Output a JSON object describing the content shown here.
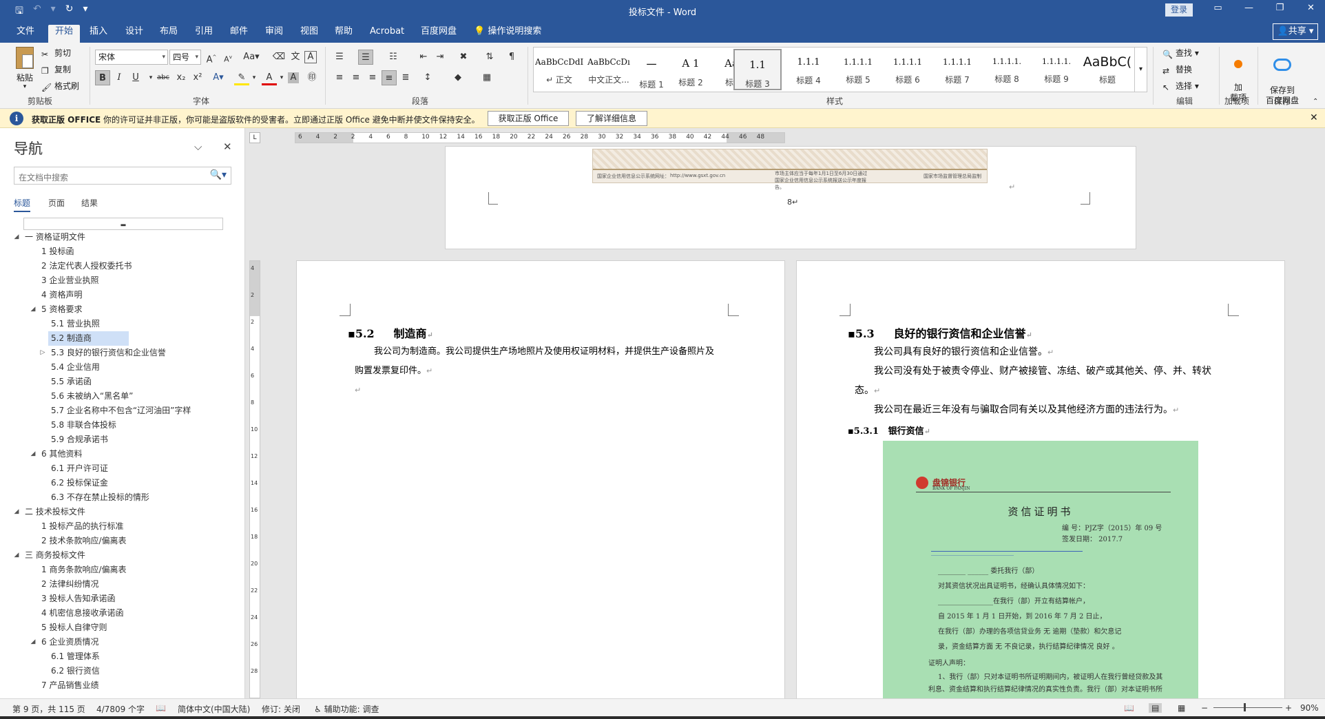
{
  "titlebar": {
    "doc_title": "投标文件 - Word",
    "login": "登录",
    "save_icon": "save-icon",
    "undo_icon": "undo-icon",
    "redo_icon": "redo-icon",
    "customize_icon": "customize-qat-icon"
  },
  "menu": {
    "tabs": [
      "文件",
      "开始",
      "插入",
      "设计",
      "布局",
      "引用",
      "邮件",
      "审阅",
      "视图",
      "帮助",
      "Acrobat",
      "百度网盘"
    ],
    "active_tab": "开始",
    "tell_me": "操作说明搜索",
    "share": "共享"
  },
  "ribbon": {
    "clipboard": {
      "label": "剪贴板",
      "paste": "粘贴",
      "cut": "剪切",
      "copy": "复制",
      "format_painter": "格式刷"
    },
    "font": {
      "label": "字体",
      "font_name": "宋体",
      "font_size": "四号",
      "bold": "B",
      "italic": "I",
      "underline": "U",
      "strike": "abc",
      "subscript": "x₂",
      "superscript": "x²"
    },
    "paragraph": {
      "label": "段落"
    },
    "styles": {
      "label": "样式",
      "items": [
        {
          "preview": "AaBbCcDdI",
          "name": "↵ 正文"
        },
        {
          "preview": "AaBbCcDı",
          "name": "中文正文..."
        },
        {
          "preview": "一",
          "name": "标题 1"
        },
        {
          "preview": "A 1",
          "name": "标题 2"
        },
        {
          "preview": "AaI",
          "name": "标题"
        },
        {
          "preview": "1.1",
          "name": "标题 3"
        },
        {
          "preview": "1.1.1",
          "name": "标题 4"
        },
        {
          "preview": "1.1.1.1",
          "name": "标题 5"
        },
        {
          "preview": "1.1.1.1",
          "name": "标题 6"
        },
        {
          "preview": "1.1.1.1",
          "name": "标题 7"
        },
        {
          "preview": "1.1.1.1.",
          "name": "标题 8"
        },
        {
          "preview": "1.1.1.1.",
          "name": "标题 9"
        },
        {
          "preview": "AaBbC(",
          "name": "标题"
        }
      ],
      "selected_index": 5
    },
    "editing": {
      "label": "编辑",
      "find": "查找",
      "replace": "替换",
      "select": "选择"
    },
    "addins": {
      "label": "加载项",
      "button": "加\n载项"
    },
    "save": {
      "label": "保存",
      "button": "保存到\n百度网盘"
    }
  },
  "infobar": {
    "icon": "info-icon",
    "bold": "获取正版 OFFICE",
    "message": "你的许可证并非正版，你可能是盗版软件的受害者。立即通过正版 Office 避免中断并使文件保持安全。",
    "btn_get": "获取正版 Office",
    "btn_learn": "了解详细信息"
  },
  "nav": {
    "title": "导航",
    "search_placeholder": "在文档中搜索",
    "tabs": [
      "标题",
      "页面",
      "结果"
    ],
    "active_tab": "标题",
    "tree": [
      {
        "level": 0,
        "toggle": "◢",
        "label": "一 资格证明文件"
      },
      {
        "level": 1,
        "toggle": "",
        "label": "1 投标函"
      },
      {
        "level": 1,
        "toggle": "",
        "label": "2 法定代表人授权委托书"
      },
      {
        "level": 1,
        "toggle": "",
        "label": "3 企业营业执照"
      },
      {
        "level": 1,
        "toggle": "",
        "label": "4 资格声明"
      },
      {
        "level": 1,
        "toggle": "◢",
        "label": "5 资格要求"
      },
      {
        "level": 2,
        "toggle": "",
        "label": "5.1 营业执照"
      },
      {
        "level": 2,
        "toggle": "",
        "label": "5.2 制造商",
        "selected": true
      },
      {
        "level": 2,
        "toggle": "▷",
        "label": "5.3 良好的银行资信和企业信誉"
      },
      {
        "level": 2,
        "toggle": "",
        "label": "5.4 企业信用"
      },
      {
        "level": 2,
        "toggle": "",
        "label": "5.5 承诺函"
      },
      {
        "level": 2,
        "toggle": "",
        "label": "5.6 未被纳入“黑名单”"
      },
      {
        "level": 2,
        "toggle": "",
        "label": "5.7 企业名称中不包含“辽河油田”字样"
      },
      {
        "level": 2,
        "toggle": "",
        "label": "5.8 非联合体投标"
      },
      {
        "level": 2,
        "toggle": "",
        "label": "5.9 合规承诺书"
      },
      {
        "level": 1,
        "toggle": "◢",
        "label": "6 其他资料"
      },
      {
        "level": 2,
        "toggle": "",
        "label": "6.1 开户许可证"
      },
      {
        "level": 2,
        "toggle": "",
        "label": "6.2 投标保证金"
      },
      {
        "level": 2,
        "toggle": "",
        "label": "6.3 不存在禁止投标的情形"
      },
      {
        "level": 0,
        "toggle": "◢",
        "label": "二 技术投标文件"
      },
      {
        "level": 1,
        "toggle": "",
        "label": "1 投标产品的执行标准"
      },
      {
        "level": 1,
        "toggle": "",
        "label": "2 技术条款响应/偏离表"
      },
      {
        "level": 0,
        "toggle": "◢",
        "label": "三 商务投标文件"
      },
      {
        "level": 1,
        "toggle": "",
        "label": "1 商务条款响应/偏离表"
      },
      {
        "level": 1,
        "toggle": "",
        "label": "2 法律纠纷情况"
      },
      {
        "level": 1,
        "toggle": "",
        "label": "3 投标人告知承诺函"
      },
      {
        "level": 1,
        "toggle": "",
        "label": "4 机密信息接收承诺函"
      },
      {
        "level": 1,
        "toggle": "",
        "label": "5 投标人自律守则"
      },
      {
        "level": 1,
        "toggle": "◢",
        "label": "6 企业资质情况"
      },
      {
        "level": 2,
        "toggle": "",
        "label": "6.1 管理体系"
      },
      {
        "level": 2,
        "toggle": "",
        "label": "6.2 银行资信"
      },
      {
        "level": 1,
        "toggle": "",
        "label": "7 产品销售业绩"
      }
    ]
  },
  "ruler": {
    "h_labels": [
      "6",
      "4",
      "2",
      "2",
      "4",
      "6",
      "8",
      "10",
      "12",
      "14",
      "16",
      "18",
      "20",
      "22",
      "24",
      "26",
      "28",
      "30",
      "32",
      "34",
      "36",
      "38",
      "40",
      "42",
      "44",
      "46",
      "48"
    ],
    "v_labels": [
      "4",
      "2",
      "2",
      "4",
      "6",
      "8",
      "10",
      "12",
      "14",
      "16",
      "18",
      "20",
      "22",
      "24",
      "26",
      "28"
    ],
    "corner": "L"
  },
  "document": {
    "prev_page": {
      "page_number": "8↵",
      "cert_left": "国家企业信用信息公示系统网址：",
      "cert_url": "http://www.gsxt.gov.cn",
      "cert_mid": "市场主体应当于每年1月1日至6月30日通过国家企业信用信息公示系统报送公示年度报告。",
      "cert_right": "国家市场监督管理总局监制"
    },
    "left_page": {
      "heading_num": "▪5.2",
      "heading_text": "制造商",
      "body_line1": "我公司为制造商。我公司提供生产场地照片及使用权证明材料，并提供生产设备照片及",
      "body_line2": "购置发票复印件。"
    },
    "right_page": {
      "heading_num": "▪5.3",
      "heading_text": "良好的银行资信和企业信誉",
      "p1": "我公司具有良好的银行资信和企业信誉。",
      "p2_line1": "我公司没有处于被责令停业、财产被接管、冻结、破产或其他关、停、并、转状",
      "p2_line2": "态。",
      "p3": "我公司在最近三年没有与骗取合同有关以及其他经济方面的违法行为。",
      "sub_heading": "▪5.3.1",
      "sub_heading_text": "银行资信"
    },
    "bank_cert": {
      "bank_name": "盘锦银行",
      "bank_en": "BANK OF PANJIN",
      "title": "资信证明书",
      "lines": [
        "编  号：PJZ字（2015）年  09 号",
        "签发日期：  2017.7",
        "________________________",
        "________  ______  委托我行（部）",
        "对其资信状况出具证明书，经确认具体情况如下：",
        "________________在我行（部）开立有结算帐户，",
        "自 2015 年 1 月 1 日开始，到 2016 年 7 月 2 日止，",
        "在我行（部）办理的各项信贷业务  无  逾期（垫款）和欠息记",
        "录，资金结算方面  无  不良记录，执行结算纪律情况  良好 。",
        "证明人声明：",
        "1、我行（部）只对本证明书所证明期间内，被证明人在我行曾经贷款及其",
        "利息、资金结算和执行结算纪律情况的真实性负责。我行（部）对本证明书所"
      ]
    }
  },
  "status": {
    "page": "第 9 页，共 115 页",
    "words": "4/7809 个字",
    "lang": "简体中文(中国大陆)",
    "track": "修订: 关闭",
    "access": "辅助功能: 调查",
    "zoom": "90%"
  }
}
